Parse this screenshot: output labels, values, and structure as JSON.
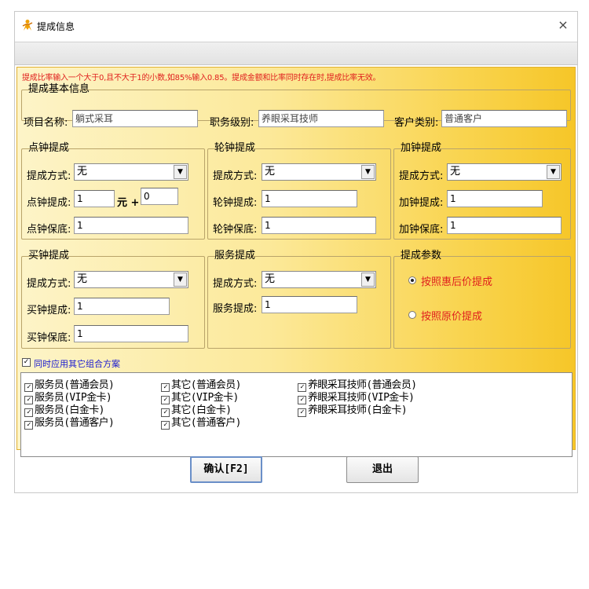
{
  "window": {
    "title": "提成信息",
    "close_glyph": "×",
    "title_icon": "person-icon"
  },
  "notice": "提成比率输入一个大于0,且不大于1的小数,如85%输入0.85。提成金额和比率同时存在时,提成比率无效。",
  "basic": {
    "legend": "提成基本信息",
    "project_label": "项目名称:",
    "project_value": "躺式采耳",
    "rank_label": "职务级别:",
    "rank_value": "养眼采耳技师",
    "customer_label": "客户类别:",
    "customer_value": "普通客户"
  },
  "dianzhong": {
    "legend": "点钟提成",
    "method_label": "提成方式:",
    "method_value": "无",
    "comm_label": "点钟提成:",
    "comm_value": "1",
    "unit": "元 +",
    "extra_value": "0",
    "guarantee_label": "点钟保底:",
    "guarantee_value": "1"
  },
  "lunzhong": {
    "legend": "轮钟提成",
    "method_label": "提成方式:",
    "method_value": "无",
    "comm_label": "轮钟提成:",
    "comm_value": "1",
    "guarantee_label": "轮钟保底:",
    "guarantee_value": "1"
  },
  "jiazhong": {
    "legend": "加钟提成",
    "method_label": "提成方式:",
    "method_value": "无",
    "comm_label": "加钟提成:",
    "comm_value": "1",
    "guarantee_label": "加钟保底:",
    "guarantee_value": "1"
  },
  "maizhong": {
    "legend": "买钟提成",
    "method_label": "提成方式:",
    "method_value": "无",
    "comm_label": "买钟提成:",
    "comm_value": "1",
    "guarantee_label": "买钟保底:",
    "guarantee_value": "1"
  },
  "service": {
    "legend": "服务提成",
    "method_label": "提成方式:",
    "method_value": "无",
    "comm_label": "服务提成:",
    "comm_value": "1"
  },
  "params": {
    "legend": "提成参数",
    "option1": "按照惠后价提成",
    "option2": "按照原价提成",
    "selected": "option1"
  },
  "combine": {
    "label": "同时应用其它组合方案",
    "checked": true,
    "items": [
      "服务员(普通会员)",
      "服务员(VIP金卡)",
      "服务员(白金卡)",
      "服务员(普通客户)",
      "其它(普通会员)",
      "其它(VIP金卡)",
      "其它(白金卡)",
      "其它(普通客户)",
      "养眼采耳技师(普通会员)",
      "养眼采耳技师(VIP金卡)",
      "养眼采耳技师(白金卡)"
    ]
  },
  "buttons": {
    "confirm": "确认[F2]",
    "exit": "退出"
  },
  "colors": {
    "notice": "#e0201e",
    "combine_label": "#1a1ad0",
    "panel_gradient_end": "#f6c628"
  }
}
